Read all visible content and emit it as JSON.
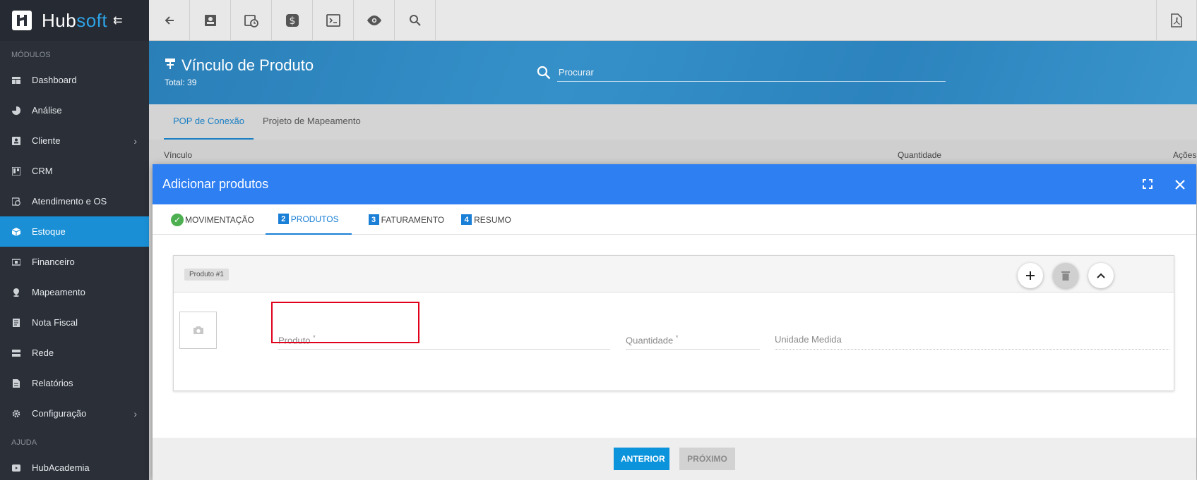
{
  "app": {
    "brand_prefix": "Hub",
    "brand_accent": "soft"
  },
  "sidebar": {
    "section_modules": "MÓDULOS",
    "section_help": "AJUDA",
    "items": [
      {
        "label": "Dashboard",
        "icon": "dashboard-icon"
      },
      {
        "label": "Análise",
        "icon": "pie-chart-icon"
      },
      {
        "label": "Cliente",
        "icon": "contact-card-icon"
      },
      {
        "label": "CRM",
        "icon": "kanban-icon"
      },
      {
        "label": "Atendimento e OS",
        "icon": "calendar-clock-icon"
      },
      {
        "label": "Estoque",
        "icon": "box-icon"
      },
      {
        "label": "Financeiro",
        "icon": "money-icon"
      },
      {
        "label": "Mapeamento",
        "icon": "map-pin-icon"
      },
      {
        "label": "Nota Fiscal",
        "icon": "receipt-icon"
      },
      {
        "label": "Rede",
        "icon": "server-icon"
      },
      {
        "label": "Relatórios",
        "icon": "report-icon"
      },
      {
        "label": "Configuração",
        "icon": "gear-icon"
      }
    ],
    "help_items": [
      {
        "label": "HubAcademia",
        "icon": "play-icon"
      }
    ]
  },
  "header": {
    "title": "Vínculo de Produto",
    "total": "Total: 39",
    "search_placeholder": "Procurar"
  },
  "page_tabs": [
    "POP de Conexão",
    "Projeto de Mapeamento"
  ],
  "columns": {
    "vinculo": "Vínculo",
    "quantidade": "Quantidade",
    "acoes": "Ações"
  },
  "modal": {
    "title": "Adicionar produtos",
    "steps": [
      {
        "num": "",
        "label": "MOVIMENTAÇÃO"
      },
      {
        "num": "2",
        "label": "PRODUTOS"
      },
      {
        "num": "3",
        "label": "FATURAMENTO"
      },
      {
        "num": "4",
        "label": "RESUMO"
      }
    ],
    "card_chip": "Produto #1",
    "fields": {
      "produto": "Produto",
      "quantidade": "Quantidade",
      "unidade": "Unidade Medida",
      "required_mark": "*"
    },
    "buttons": {
      "anterior": "ANTERIOR",
      "proximo": "PRÓXIMO"
    }
  },
  "colors": {
    "sidebar_bg": "#2a2f38",
    "active_nav": "#1a8fd6",
    "modal_header": "#2d7ff2",
    "highlight": "#e0001b"
  }
}
